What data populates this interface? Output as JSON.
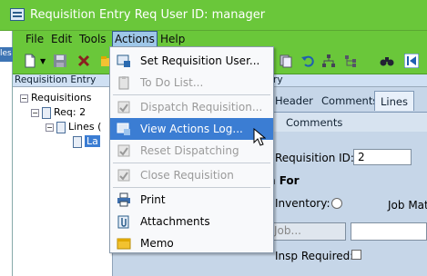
{
  "window": {
    "title": "Requisition Entry Req User ID: manager",
    "accent": "#6ac73a"
  },
  "left_strip": {
    "fragment": "les"
  },
  "menubar": {
    "items": [
      {
        "label": "File"
      },
      {
        "label": "Edit"
      },
      {
        "label": "Tools"
      },
      {
        "label": "Actions"
      },
      {
        "label": "Help"
      }
    ]
  },
  "left_pane": {
    "header": "Requisition Entry",
    "tree": [
      {
        "label": "Requisitions"
      },
      {
        "label": "Req: 2"
      },
      {
        "label": "Lines ("
      },
      {
        "label": "La"
      }
    ]
  },
  "right_pane": {
    "header_fragment": "ry",
    "tabs": [
      {
        "label": "Header"
      },
      {
        "label": "Comments"
      },
      {
        "label": "Lines"
      }
    ],
    "subtab": "Comments",
    "form": {
      "requisition_id_label": "Requisition ID:",
      "requisition_id_value": "2",
      "section_label": "n For",
      "inventory_label": "Inventory:",
      "job_mat_label": "Job Mat",
      "job_placeholder": "Job...",
      "insp_required_label": "Insp Required:"
    }
  },
  "actions_menu": {
    "items": [
      {
        "label": "Set Requisition User...",
        "enabled": true,
        "icon": "user-icon"
      },
      {
        "label": "To Do List...",
        "enabled": false,
        "icon": "clipboard-icon"
      },
      {
        "label": "Dispatch Requisition...",
        "enabled": false,
        "icon": "dispatch-icon"
      },
      {
        "label": "View Actions Log...",
        "enabled": true,
        "icon": "log-icon",
        "highlighted": true
      },
      {
        "label": "Reset Dispatching",
        "enabled": false,
        "icon": "reset-icon"
      },
      {
        "label": "Close Requisition",
        "enabled": false,
        "icon": "close-req-icon"
      },
      {
        "label": "Print",
        "enabled": true,
        "icon": "printer-icon"
      },
      {
        "label": "Attachments",
        "enabled": true,
        "icon": "paperclip-icon"
      },
      {
        "label": "Memo",
        "enabled": true,
        "icon": "memo-icon"
      }
    ]
  }
}
